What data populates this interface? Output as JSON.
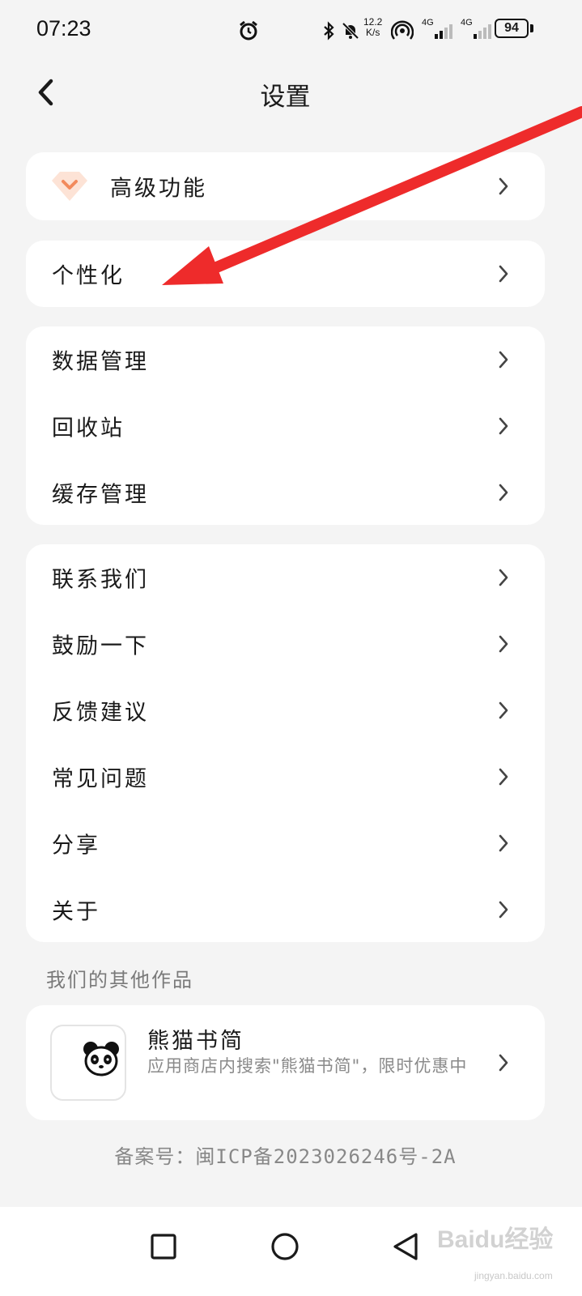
{
  "status_bar": {
    "time": "07:23",
    "speed_value": "12.2",
    "speed_unit": "K/s",
    "net1": "4G",
    "net2": "4G",
    "battery": "94",
    "icons": [
      "alarm-icon",
      "bluetooth-icon",
      "mute-icon",
      "hotspot-icon",
      "signal-icon",
      "signal-icon",
      "battery-icon"
    ]
  },
  "header": {
    "title": "设置",
    "back_icon": "chevron-left-icon"
  },
  "premium": {
    "label": "高级功能",
    "icon": "diamond-icon",
    "accent": "#f7a07a"
  },
  "personalize": {
    "label": "个性化"
  },
  "data_group": {
    "items": [
      {
        "label": "数据管理"
      },
      {
        "label": "回收站"
      },
      {
        "label": "缓存管理"
      }
    ]
  },
  "support_group": {
    "items": [
      {
        "label": "联系我们"
      },
      {
        "label": "鼓励一下"
      },
      {
        "label": "反馈建议"
      },
      {
        "label": "常见问题"
      },
      {
        "label": "分享"
      },
      {
        "label": "关于"
      }
    ]
  },
  "other_works": {
    "section_label": "我们的其他作品",
    "app_name": "熊猫书简",
    "app_desc": "应用商店内搜索\"熊猫书简\"，限时优惠中",
    "app_icon": "panda-icon"
  },
  "footer": {
    "icp": "备案号：闽ICP备2023026246号-2A"
  },
  "nav": {
    "icons": [
      "recents-square-icon",
      "home-circle-icon",
      "back-triangle-icon"
    ]
  },
  "watermark": {
    "text": "Baidu经验",
    "sub": "jingyan.baidu.com"
  },
  "colors": {
    "background": "#f4f4f4",
    "card": "#ffffff",
    "annotation_arrow": "#ee2b2b"
  }
}
